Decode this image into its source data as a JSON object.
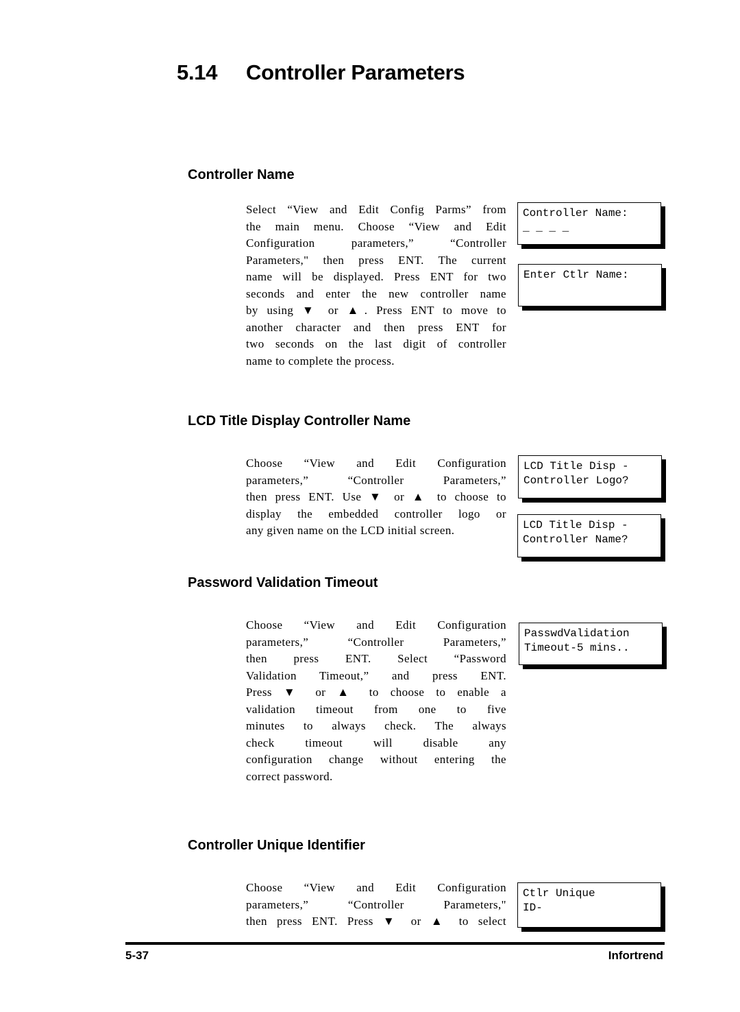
{
  "page": {
    "section_number": "5.14",
    "title": "Controller Parameters"
  },
  "sections": [
    {
      "heading": "Controller Name",
      "lines": [
        "Select “View and Edit Config Parms” from",
        "the main menu.  Choose “View and Edit",
        "Configuration parameters,” “Controller",
        "Parameters,\" then press ENT.  The current",
        "name will be displayed. Press ENT for two",
        "seconds and enter the new controller name",
        "by using ▼ or ▲.  Press ENT to move to",
        "another character and then press ENT for",
        "two seconds on the last digit of controller",
        "name to complete the process."
      ],
      "lcd_screens": [
        {
          "line1": "Controller Name:",
          "line2": "_ _ _ _"
        },
        {
          "line1": "Enter Ctlr Name:",
          "line2": ""
        }
      ]
    },
    {
      "heading": "LCD Title Display Controller Name",
      "lines": [
        "Choose “View and Edit Configuration",
        "parameters,” “Controller Parameters,”",
        "then press ENT.  Use ▼ or ▲ to choose to",
        "display the embedded controller logo or",
        "any given name on the LCD initial screen."
      ],
      "lcd_screens": [
        {
          "line1": "LCD Title Disp -",
          "line2": "Controller Logo?"
        },
        {
          "line1": "LCD Title Disp -",
          "line2": "Controller Name?"
        }
      ]
    },
    {
      "heading": "Password Validation Timeout",
      "lines": [
        "Choose “View and Edit Configuration",
        "parameters,” “Controller Parameters,”",
        "then press ENT.  Select “Password",
        "Validation Timeout,” and press ENT.",
        "Press ▼ or ▲ to choose to enable a",
        "validation timeout from one to five",
        "minutes to always check.  The always",
        "check timeout will disable any",
        "configuration change without entering the",
        "correct password."
      ],
      "lcd_screens": [
        {
          "line1": "PasswdValidation",
          "line2": "Timeout-5 mins.."
        }
      ]
    },
    {
      "heading": "Controller Unique Identifier",
      "lines": [
        "Choose “View and Edit Configuration",
        "parameters,” “Controller Parameters,\"",
        "then press ENT.  Press ▼ or ▲ to select"
      ],
      "lcd_screens": [
        {
          "line1": "Ctlr Unique",
          "line2": "ID-"
        }
      ]
    }
  ],
  "footer": {
    "page_number": "5-37",
    "brand": "Infortrend"
  }
}
